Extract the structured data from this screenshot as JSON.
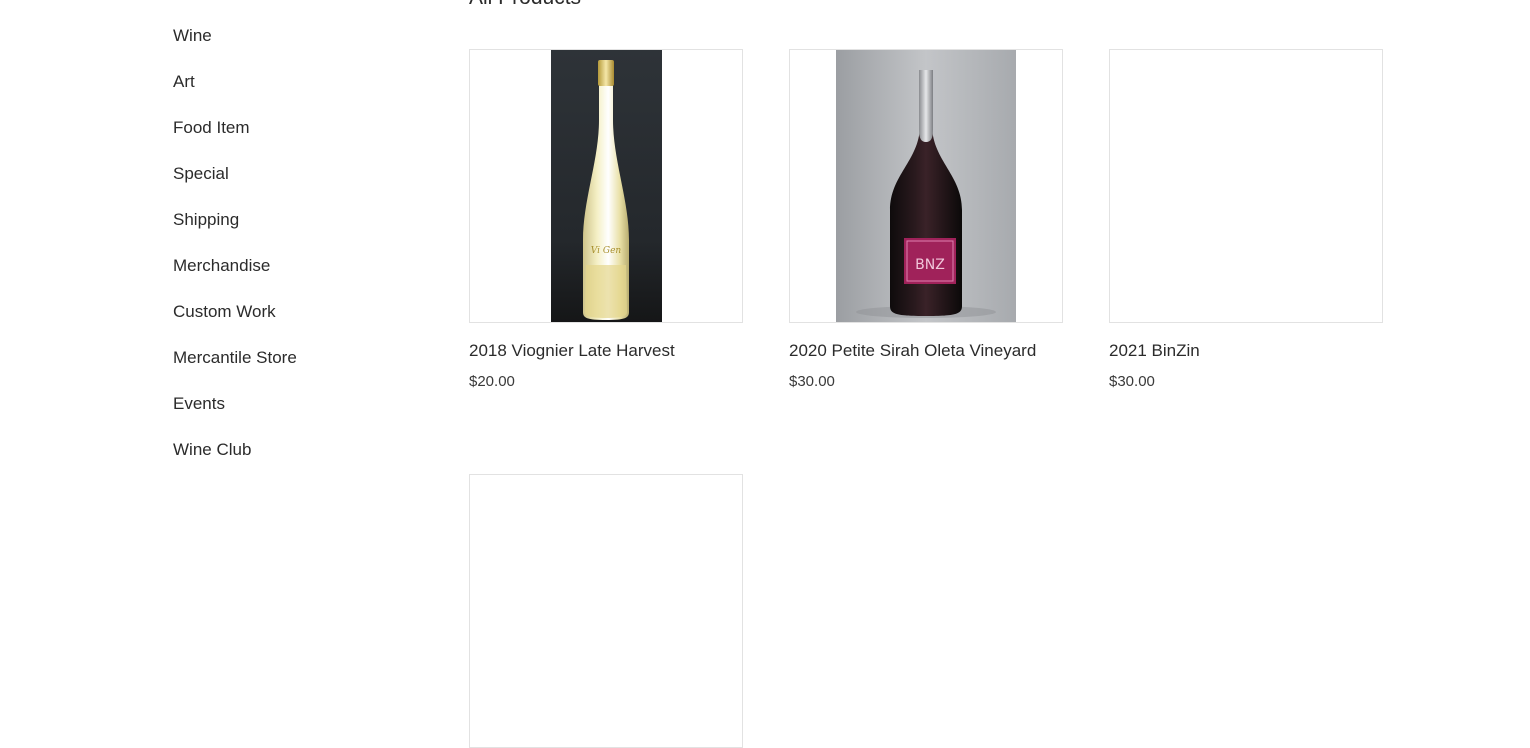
{
  "page_title": "All Products",
  "categories": [
    "Wine",
    "Art",
    "Food Item",
    "Special",
    "Shipping",
    "Merchandise",
    "Custom Work",
    "Mercantile Store",
    "Events",
    "Wine Club"
  ],
  "products": [
    {
      "name": "2018 Viognier Late Harvest",
      "price": "$20.00",
      "image": "tall-clear-bottle",
      "label_text": "Vi Gen"
    },
    {
      "name": "2020 Petite Sirah Oleta Vineyard",
      "price": "$30.00",
      "image": "dark-red-bottle",
      "label_text": "BNZ"
    },
    {
      "name": "2021 BinZin",
      "price": "$30.00",
      "image": "none"
    }
  ],
  "colors": {
    "text": "#2b2b2b",
    "border": "#e2e2e2",
    "label_magenta": "#a0225a"
  }
}
